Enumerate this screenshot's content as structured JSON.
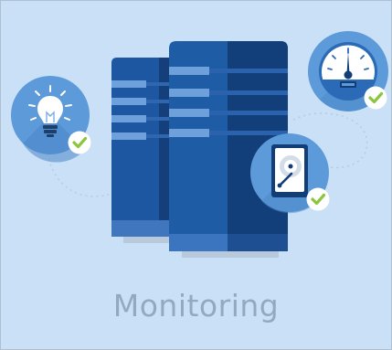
{
  "caption": {
    "text": "Monitoring"
  },
  "icons": {
    "servers": "server-rack-icon",
    "lightbulb": "lightbulb-icon",
    "speedometer": "speedometer-icon",
    "hard_drive": "hard-drive-icon",
    "check": "checkmark-icon"
  },
  "colors": {
    "background": "#c9e0f6",
    "server_dark": "#123d77",
    "server_mid": "#1f5ca3",
    "server_light": "#3d7cc6",
    "circle": "#5d9ada",
    "check": "#8cc63f",
    "text": "#93a9bf"
  }
}
